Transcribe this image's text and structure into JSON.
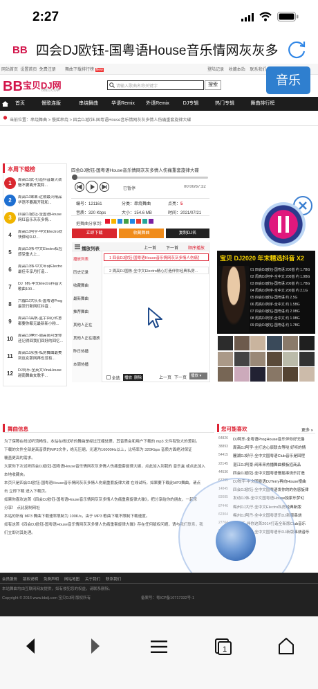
{
  "status": {
    "time": "2:27"
  },
  "browser": {
    "title": "四会DJ欧钰-国粤语House音乐情网灰灰多"
  },
  "site": {
    "topbar": {
      "left": [
        "网站首页",
        "设置首页",
        "免费注册"
      ],
      "newlabel": "舞曲下载排行榜",
      "badge": "New",
      "right": [
        "登陆记录",
        "收藏本站",
        "联系我们"
      ]
    },
    "logo": {
      "text": "宝贝DJ网",
      "sub": "BBDJ.COM"
    },
    "search": {
      "placeholder": "请输入歌曲名称关键字",
      "button": "搜索"
    },
    "music_btn": "音乐",
    "nav": [
      "首页",
      "慢歌连版",
      "串烧舞曲",
      "华语Remix",
      "外语Remix",
      "DJ专辑",
      "热门专辑",
      "舞曲排行榜"
    ],
    "breadcrumb": "当前位置：串烧舞曲 > 慢摇串烧 > 四会DJ欧钰-国粤语House音乐情网灰灰多情人伤痛重套旋律大碟",
    "rank": {
      "title": "本周下载榜",
      "items": [
        {
          "n": "1",
          "t": "周高DJ武-打造抖音最火劲魅不要离开我和..."
        },
        {
          "n": "2",
          "t": "周高DJ果果-近期最火精品华语不要离开我和..."
        },
        {
          "n": "3",
          "t": "四会DJ欧钰-全国语House网红音乐灰灰多情..."
        },
        {
          "n": "4",
          "t": "周高DJ阿宇-中文Electro欢快律动DJ2..."
        },
        {
          "n": "5",
          "t": "周高DJ伟-中文Electro私控感受重大上..."
        },
        {
          "n": "6",
          "t": "周高DJ伟-中文年诗Electro最佳专享月打造..."
        },
        {
          "n": "7",
          "t": "DJ飞机-中文Electro抖音火歌曲100..."
        },
        {
          "n": "8",
          "t": "六福DJ大队长-国粤语Prog最流行新网红抖音..."
        },
        {
          "n": "9",
          "t": "周高DJ高帆-蓝宇回心转意都要你都无最新新小粉..."
        },
        {
          "n": "10",
          "t": "周高DJ神轩-周高简可是你还记得回我们回好的回忆..."
        },
        {
          "n": "11",
          "t": "周高DJ永强-私房舞曲最美到这女那网再也没有..."
        },
        {
          "n": "12",
          "t": "DJ阿乐-全英文VinaHouse越南舞曲女歌手..."
        }
      ]
    },
    "player": {
      "title": "四会DJ欧钰-国粤语House音乐情网灰灰多情人伤痛重套旋律大碟",
      "status": "已暂停",
      "time": "00:00/67:32",
      "meta": [
        {
          "k": "编号：",
          "v": "121161"
        },
        {
          "k": "分类：",
          "v": "串烧舞曲"
        },
        {
          "k": "点亮：",
          "v": "5"
        },
        {
          "k": "音质：",
          "v": "320 Kbps"
        },
        {
          "k": "大小：",
          "v": "154.6 MB"
        },
        {
          "k": "时间：",
          "v": "2021/07/21"
        }
      ],
      "share_label": "把舞曲分享到:",
      "btn_download": "立即下载",
      "btn_fav": "收藏舞曲",
      "btn_rename": "复制DJ名"
    },
    "playlist": {
      "title": "播放列表",
      "prev": "上一首",
      "next": "下一首",
      "mode": "顺序播放",
      "side": [
        "播放列表",
        "历史记录",
        "收藏舞曲",
        "最新舞曲",
        "推荐舞曲",
        "其他人正在",
        "其他人正在播放",
        "昨日热播",
        "本周热播"
      ],
      "items": [
        "1  四会DJ欧钰-国粤语House音乐情网灰灰多情人伤痛重套旋律大碟",
        "2  周高DJ国栋-全中文Electro精心打造伴你经典私房..."
      ],
      "footer": {
        "all": "全选",
        "play": "播放",
        "del": "删除",
        "prev": "上一页",
        "next": "下一页",
        "sel": "播放"
      }
    },
    "ad": {
      "title": "宝贝 DJ2020 年末精选抖音 X2",
      "rows": [
        "01 四会DJ欧钰-国粤语 200首  约 1.7BG",
        "02 周高DJ阿宇-全中文 200首  约 1.9BG",
        "03 四会DJ欧钰-国粤语 200首  约 1.7BG",
        "04 周高DJ阿宇-全中文 200首  约 2.1G",
        "05 四会DJ欧钰-国粤语       约 2.5G",
        "06 周高DJ阿宇-全中文       约 1.5BG",
        "07 四会DJ欧钰-国粤语       约 2.9BG",
        "08 周高DJ阿宇-全中文       约 1.9BG",
        "09 四会DJ欧钰-国粤语       约 1.7BG"
      ]
    },
    "info": {
      "title": "舞曲信息",
      "lines": [
        "为了保障在线试听流畅性，本站在线试听的舞曲是经过压缩处理，其音质会和用户下载的 mp3 文件有较大的差别。",
        "下载的文件全部是高音质的MP3文件，绝无压缩，光速为16000Hz以上，比特率为 320Kbps 音质方面绝对保证",
        "覆盖更高的需求。",
        "大家你下次试听四会DJ欧钰-国粤语House音乐情网灰灰多情人伤痛重套旋律大碟，点此加入到我的 音乐盒 或点此加入",
        "本地收藏夹。",
        "本页只是四会DJ欧钰-国粤语House音乐情网灰灰多情人伤痛重套旋律大碟 在线试听，如果要下载此MP3舞曲，请点",
        "击 立即下载 进入下载页。",
        "如果你喜欢这首《四会DJ欧钰-国粤语House音乐情网灰灰多情人伤痛重套旋律大碟》，把分享给你的朋友，一起来",
        "分享！ 点此复制网址",
        "本站的所有 MP3 舞曲下载速率限制为 100K/s，由于 MP3 歌曲下载不限制下载速度。",
        "如有这首《四会DJ欧钰-国粤语House音乐情网灰灰多情人伤痛重套旋律大碟》存在任何版权问题，请与我们联系，我",
        "们立即对其处理。"
      ]
    },
    "like": {
      "title": "您可能喜欢",
      "more": "更多 »",
      "items": [
        {
          "id": "64826",
          "t": "DJ阿乐-全粤语ProgHouse音乐伴你好无鲁"
        },
        {
          "id": "38893",
          "t": "周高DJ阿宇-主打这心辰联去等哒 好听的情"
        },
        {
          "id": "54415",
          "t": "麓湖DJ好仔-全中文国粤语Club音乐是回程"
        },
        {
          "id": "22145",
          "t": "湛江DJ阿豪-阀来来热播舞曲模板招商品"
        },
        {
          "id": "44536",
          "t": "四会DJ欧钰-全中文国粤语慢摇串烧乐打造"
        },
        {
          "id": "67295",
          "t": "DJ陈宇-中文国粤语DJTerry再向House慢曲"
        },
        {
          "id": "14845",
          "t": "四会DJ欧钰-全中文国粤语发你的的伤感旋律"
        },
        {
          "id": "83085",
          "t": "发动DJ伟-全中文国粤语House独家乐梦幻"
        },
        {
          "id": "87446",
          "t": "梅州DJ大仔-全中文Electro私房经典新版"
        },
        {
          "id": "62304",
          "t": "梅州DJ阿丹-全中文国粤语乐DJ新版串烧"
        },
        {
          "id": "27764",
          "t": "DJ阿乐-伴你这首2014打造全新版Club音乐"
        },
        {
          "id": "97486",
          "t": "四会DJ阿明-全中文国粤语乐DJ新版串烧音乐"
        }
      ]
    },
    "footer": {
      "links": [
        "会员服务",
        "版权说明",
        "免费声明",
        "网站地图",
        "关于我们",
        "联系我们"
      ],
      "notice": "本站舞曲均由互联网网友提供，如有侵犯您的权益，请联系删除。",
      "copyright": "Copyright © 2016 www.bbdj.com 宝贝DJ网 版权所有",
      "beian": "备案号：粤ICP备10717332号-1"
    }
  },
  "toolbar": [
    "back",
    "forward",
    "menu",
    "tabs",
    "home"
  ]
}
